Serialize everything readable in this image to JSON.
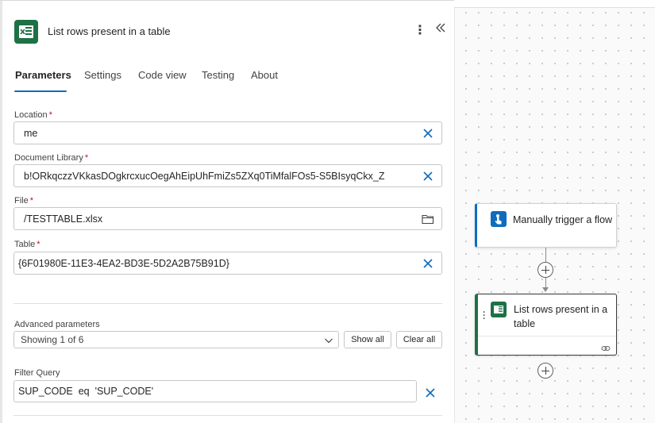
{
  "panel": {
    "title": "List rows present in a table",
    "tabs": [
      {
        "label": "Parameters",
        "active": true
      },
      {
        "label": "Settings"
      },
      {
        "label": "Code view"
      },
      {
        "label": "Testing"
      },
      {
        "label": "About"
      }
    ],
    "fields": {
      "location": {
        "label": "Location",
        "required_mark": "*",
        "value": "me"
      },
      "document_library": {
        "label": "Document Library",
        "required_mark": "*",
        "value": "b!ORkqczzVKkasDOgkrcxucOegAhEipUhFmiZs5ZXq0TiMfalFOs5-S5BIsyqCkx_Z"
      },
      "file": {
        "label": "File",
        "required_mark": "*",
        "value": "/TESTTABLE.xlsx"
      },
      "table": {
        "label": "Table",
        "required_mark": "*",
        "value": "{6F01980E-11E3-4EA2-BD3E-5D2A2B75B91D}"
      }
    },
    "advanced": {
      "label": "Advanced parameters",
      "dropdown_value": "Showing 1 of 6",
      "show_all_label": "Show all",
      "clear_all_label": "Clear all"
    },
    "filter_query": {
      "label": "Filter Query",
      "value": "SUP_CODE  eq  'SUP_CODE'"
    }
  },
  "canvas": {
    "trigger_card": {
      "title": "Manually trigger a flow"
    },
    "action_card": {
      "title": "List rows present in a table"
    }
  },
  "colors": {
    "accent": "#0f6cbd",
    "excel_green": "#1e7145",
    "required": "#c50f1f"
  }
}
